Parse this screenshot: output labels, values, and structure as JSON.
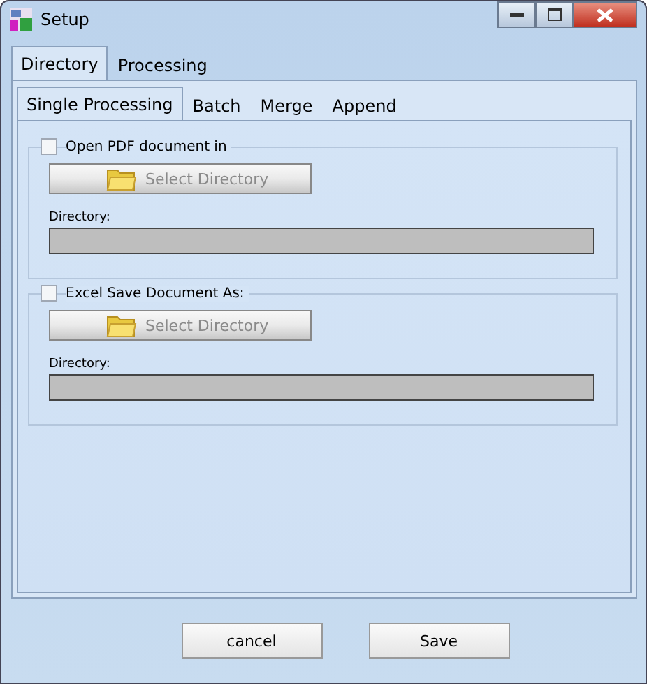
{
  "window": {
    "title": "Setup"
  },
  "tabs": [
    {
      "label": "Directory",
      "selected": true
    },
    {
      "label": "Processing",
      "selected": false
    }
  ],
  "subtabs": [
    {
      "label": "Single Processing",
      "selected": true
    },
    {
      "label": "Batch",
      "selected": false
    },
    {
      "label": "Merge",
      "selected": false
    },
    {
      "label": "Append",
      "selected": false
    }
  ],
  "groups": [
    {
      "label": "Open PDF document in",
      "checked": false,
      "button": {
        "label": "Select Directory",
        "disabled": true
      },
      "field_label": "Directory:"
    },
    {
      "label": "Excel Save Document As:",
      "checked": false,
      "button": {
        "label": "Select Directory",
        "disabled": true
      },
      "field_label": "Directory:"
    }
  ],
  "buttons": [
    "cancel",
    "Save"
  ]
}
